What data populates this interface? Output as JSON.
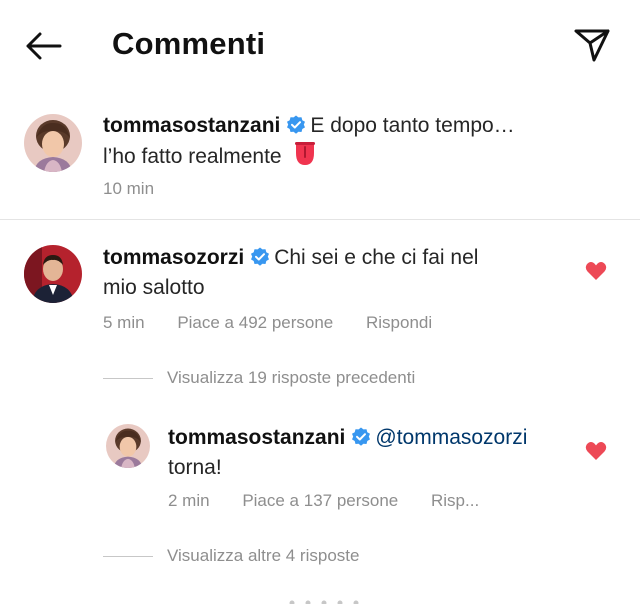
{
  "header": {
    "title": "Commenti",
    "back_icon": "arrow-left-icon",
    "send_icon": "paper-plane-icon"
  },
  "caption": {
    "username": "tommasostanzani",
    "text": "E dopo tanto tempo…",
    "text_line2": "l’ho fatto realmente",
    "emoji": "tongue-emoji",
    "time": "10 min"
  },
  "comments": [
    {
      "username": "tommasozorzi",
      "text": "Chi sei e che ci fai nel",
      "text_line2": "mio salotto",
      "time": "5 min",
      "likes": "Piace a 492 persone",
      "reply_label": "Rispondi",
      "liked": true
    }
  ],
  "view_previous": "Visualizza 19 risposte precedenti",
  "reply": {
    "username": "tommasostanzani",
    "mention": "@tommasozorzi",
    "text": "torna!",
    "time": "2 min",
    "likes": "Piace a 137 persone",
    "reply_label": "Risp...",
    "liked": true
  },
  "view_more": "Visualizza altre 4 risposte",
  "colors": {
    "heart": "#ed4956",
    "verified": "#3897f0",
    "meta": "#8e8e8e",
    "mention": "#00376b"
  }
}
